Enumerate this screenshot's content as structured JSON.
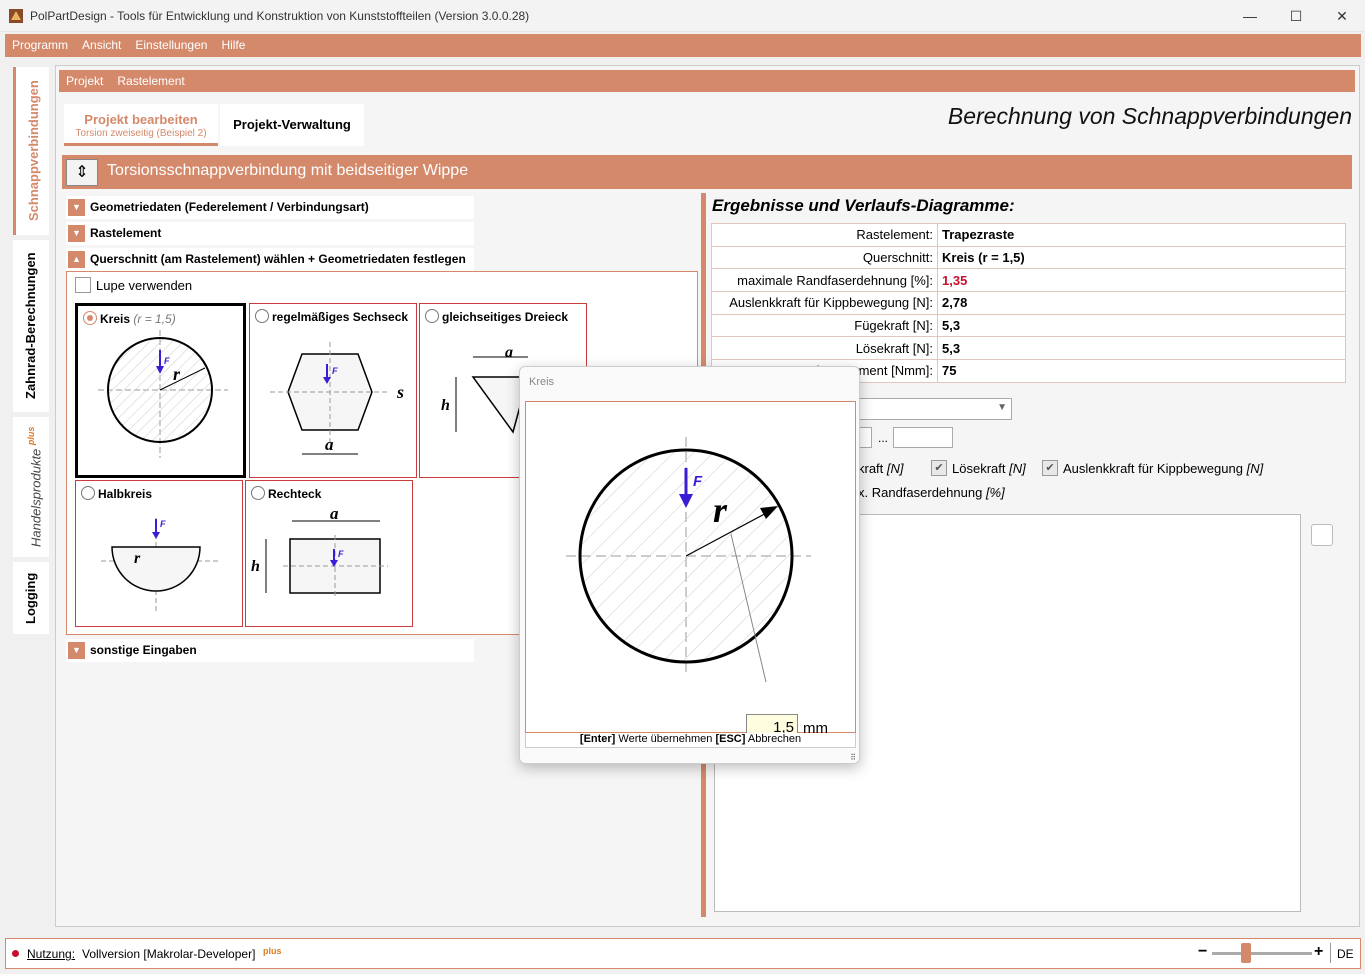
{
  "window": {
    "title": "PolPartDesign - Tools für Entwicklung und Konstruktion von Kunststoffteilen (Version 3.0.0.28)"
  },
  "menu": [
    "Programm",
    "Ansicht",
    "Einstellungen",
    "Hilfe"
  ],
  "sidebar": {
    "tabs": [
      "Schnappverbindungen",
      "Zahnrad-Berechnungen",
      "Handelsprodukte",
      "Logging"
    ],
    "plus": "plus"
  },
  "subnav": [
    "Projekt",
    "Rastelement"
  ],
  "tabs": {
    "edit_title": "Projekt bearbeiten",
    "edit_subtitle": "Torsion zweiseitig (Beispiel 2)",
    "manage": "Projekt-Verwaltung"
  },
  "heading": "Berechnung von Schnappverbindungen",
  "section": {
    "title": "Torsionsschnappverbindung mit beidseitiger Wippe",
    "toggle": "⇕"
  },
  "accordion": {
    "geo": "Geometriedaten (Federelement / Verbindungsart)",
    "rast": "Rastelement",
    "quer": "Querschnitt (am Rastelement) wählen + Geometriedaten festlegen",
    "sonst": "sonstige Eingaben"
  },
  "lupe": "Lupe verwenden",
  "shapes": {
    "kreis": "Kreis",
    "kreis_note": "(r = 1,5)",
    "sechseck": "regelmäßiges Sechseck",
    "dreieck": "gleichseitiges Dreieck",
    "halbkreis": "Halbkreis",
    "rechteck": "Rechteck"
  },
  "sym": {
    "F": "F",
    "r": "r",
    "a": "a",
    "s": "s",
    "h": "h"
  },
  "results": {
    "heading": "Ergebnisse und Verlaufs-Diagramme:",
    "rows": [
      {
        "k": "Rastelement:",
        "v": "Trapezraste"
      },
      {
        "k": "Querschnitt:",
        "v": "Kreis (r = 1,5)"
      },
      {
        "k": "maximale Randfaserdehnung [%]:",
        "v": "1,35"
      },
      {
        "k": "Auslenkkraft für Kippbewegung [N]:",
        "v": "2,78"
      },
      {
        "k": "Fügekraft [N]:",
        "v": "5,3"
      },
      {
        "k": "Lösekraft [N]:",
        "v": "5,3"
      },
      {
        "k": "Torsionsmoment [Nmm]:",
        "v": "75"
      }
    ],
    "highlight_color": "#c8102e"
  },
  "range_sep": "...",
  "checks": {
    "a": "kraft",
    "a_unit": "[N]",
    "b": "Lösekraft",
    "b_unit": "[N]",
    "c": "Auslenkkraft für Kippbewegung",
    "c_unit": "[N]",
    "d": "x. Randfaserdehnung",
    "d_unit": "[%]"
  },
  "popup": {
    "title": "Kreis",
    "value": "1,5",
    "unit": "mm",
    "enter": "[Enter]",
    "enter_text": "Werte übernehmen",
    "esc": "[ESC]",
    "esc_text": "Abbrechen"
  },
  "status": {
    "label": "Nutzung:",
    "text": "Vollversion [Makrolar-Developer]",
    "plus": "plus",
    "lang": "DE",
    "minus": "−",
    "plus_btn": "+"
  },
  "colors": {
    "accent": "#d4896a",
    "arrow": "#3a1ed6",
    "card_border": "#c83c3c"
  }
}
